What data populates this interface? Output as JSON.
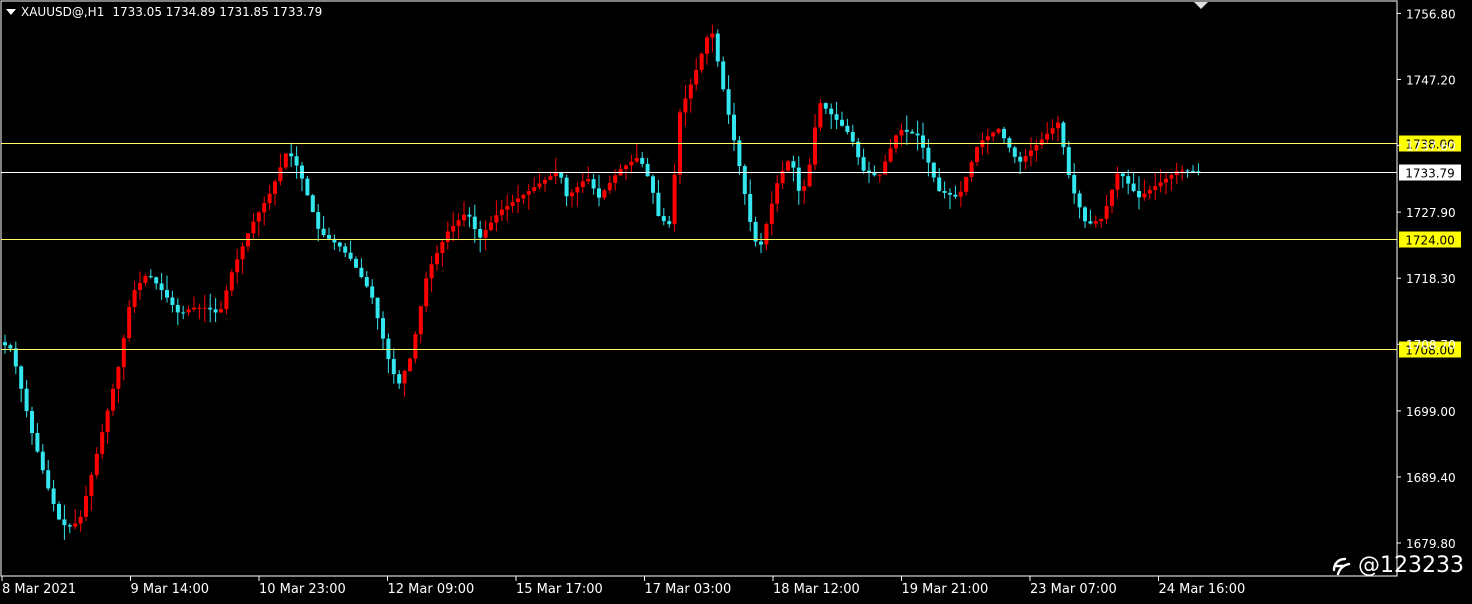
{
  "header": {
    "symbol": "XAUUSD@,H1",
    "ohlc": "1733.05 1734.89 1731.85 1733.79"
  },
  "watermark": {
    "text": "@123233",
    "icon": "logo-icon"
  },
  "colors": {
    "background": "#000000",
    "bull": "#ff0000",
    "bear": "#33e6f0",
    "level_line": "#ffff66",
    "level_box": "#ffff00",
    "price_box": "#ffffff",
    "axis": "#ffffff"
  },
  "chart_data": {
    "type": "candlestick",
    "symbol": "XAUUSD@",
    "timeframe": "H1",
    "ylim": [
      1675,
      1758.6
    ],
    "y_ticks": [
      "1756.80",
      "1747.20",
      "1737.60",
      "1727.90",
      "1718.30",
      "1708.70",
      "1699.00",
      "1689.40",
      "1679.80"
    ],
    "x_ticks": [
      "8 Mar 2021",
      "9 Mar 14:00",
      "10 Mar 23:00",
      "12 Mar 09:00",
      "15 Mar 17:00",
      "17 Mar 03:00",
      "18 Mar 12:00",
      "19 Mar 21:00",
      "23 Mar 07:00",
      "24 Mar 16:00"
    ],
    "levels": [
      {
        "value": 1738.0,
        "label": "1738.00"
      },
      {
        "value": 1724.0,
        "label": "1724.00"
      },
      {
        "value": 1708.0,
        "label": "1708.00"
      }
    ],
    "current_price": {
      "value": 1733.79,
      "label": "1733.79"
    },
    "bar_count": 222,
    "close_path": [
      [
        0,
        1709
      ],
      [
        3,
        1708
      ],
      [
        8,
        1696
      ],
      [
        12,
        1688
      ],
      [
        15,
        1683
      ],
      [
        17,
        1682
      ],
      [
        20,
        1683
      ],
      [
        24,
        1692
      ],
      [
        30,
        1706
      ],
      [
        33,
        1716
      ],
      [
        37,
        1719
      ],
      [
        40,
        1717
      ],
      [
        45,
        1713
      ],
      [
        48,
        1714
      ],
      [
        52,
        1714
      ],
      [
        55,
        1713
      ],
      [
        58,
        1719
      ],
      [
        63,
        1726
      ],
      [
        68,
        1731
      ],
      [
        72,
        1737
      ],
      [
        75,
        1734
      ],
      [
        80,
        1725
      ],
      [
        85,
        1723
      ],
      [
        88,
        1721
      ],
      [
        93,
        1716
      ],
      [
        98,
        1705
      ],
      [
        100,
        1703
      ],
      [
        103,
        1707
      ],
      [
        107,
        1719
      ],
      [
        112,
        1725
      ],
      [
        117,
        1728
      ],
      [
        120,
        1724
      ],
      [
        125,
        1728
      ],
      [
        130,
        1730
      ],
      [
        135,
        1732
      ],
      [
        140,
        1734
      ],
      [
        142,
        1730
      ],
      [
        147,
        1733
      ],
      [
        150,
        1730
      ],
      [
        155,
        1734
      ],
      [
        160,
        1736
      ],
      [
        163,
        1732
      ],
      [
        165,
        1727
      ],
      [
        168,
        1726
      ],
      [
        170,
        1742
      ],
      [
        174,
        1748
      ],
      [
        178,
        1755
      ],
      [
        181,
        1746
      ],
      [
        185,
        1735
      ],
      [
        188,
        1726
      ],
      [
        190,
        1722
      ],
      [
        195,
        1733
      ],
      [
        198,
        1736
      ],
      [
        200,
        1731
      ],
      [
        202,
        1732
      ],
      [
        205,
        1744
      ],
      [
        210,
        1741
      ],
      [
        213,
        1739
      ],
      [
        216,
        1734
      ],
      [
        220,
        1733
      ],
      [
        225,
        1740
      ],
      [
        230,
        1739
      ],
      [
        235,
        1731
      ],
      [
        240,
        1730
      ],
      [
        245,
        1738
      ],
      [
        250,
        1740
      ],
      [
        255,
        1735
      ],
      [
        260,
        1738
      ],
      [
        265,
        1741
      ],
      [
        268,
        1732
      ],
      [
        272,
        1726
      ],
      [
        276,
        1727
      ],
      [
        280,
        1734
      ],
      [
        285,
        1730
      ],
      [
        290,
        1732
      ],
      [
        295,
        1734
      ],
      [
        300,
        1733.79
      ]
    ]
  }
}
